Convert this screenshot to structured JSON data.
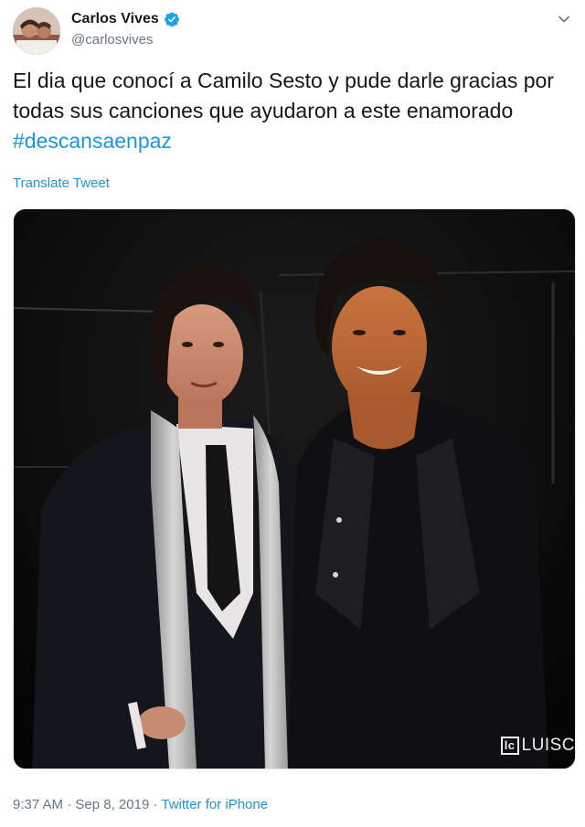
{
  "author": {
    "display_name": "Carlos Vives",
    "handle": "@carlosvives",
    "verified": true
  },
  "tweet": {
    "text_main": "El dia que conocí a Camilo Sesto y pude darle gracias por todas sus canciones que ayudaron a este enamorado ",
    "hashtag": "#descansaenpaz",
    "translate_label": "Translate Tweet"
  },
  "media": {
    "watermark_box": "lc",
    "watermark_text": "LUISC"
  },
  "meta": {
    "time": "9:37 AM",
    "separator1": " · ",
    "date": "Sep 8, 2019",
    "separator2": " · ",
    "source": "Twitter for iPhone"
  },
  "colors": {
    "link": "#1b95e0",
    "muted": "#657786",
    "verified": "#1da1f2",
    "text": "#14171a"
  },
  "icons": [
    "verified-badge-icon",
    "chevron-down-icon"
  ]
}
